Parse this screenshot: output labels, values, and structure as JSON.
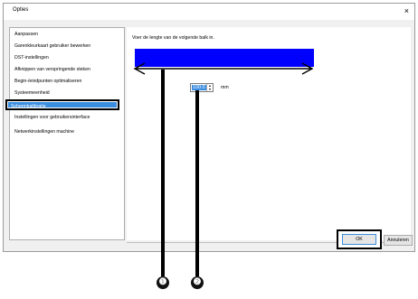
{
  "window": {
    "title": "Opties",
    "close_glyph": "×"
  },
  "sidebar": {
    "items": [
      {
        "label": "Aanpassen"
      },
      {
        "label": "Garenkleurkaart gebruiker bewerken"
      },
      {
        "label": "DST-instellingen"
      },
      {
        "label": "Afknippen van verspringende steken"
      },
      {
        "label": "Begin-/eindpunten optimaliseren"
      },
      {
        "label": "Systeemeenheid"
      },
      {
        "label": "Schermkalibratie"
      },
      {
        "label": "Instellingen voor gebruikersinterface"
      },
      {
        "label": "Netwerkinstellingen machine"
      }
    ],
    "selected_index": 6
  },
  "content": {
    "instruction": "Voer de lengte van de volgende balk in.",
    "bar_color": "#0000ff",
    "length_value": "100.0",
    "unit": "mm"
  },
  "buttons": {
    "ok": "OK",
    "cancel": "Annuleren"
  },
  "callouts": [
    "❶",
    "❷"
  ]
}
